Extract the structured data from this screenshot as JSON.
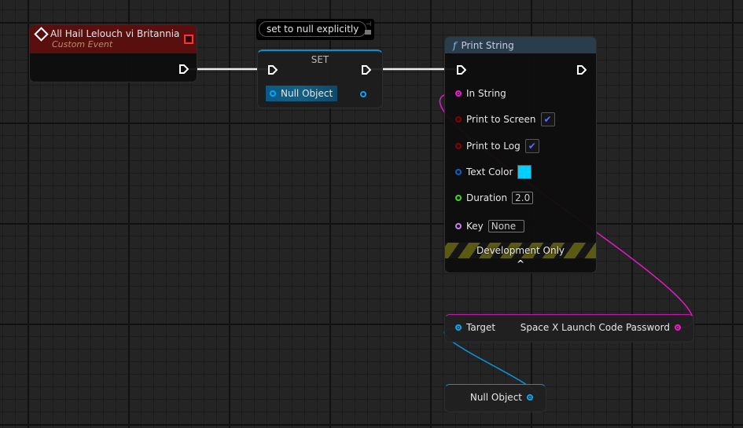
{
  "event_node": {
    "title": "All Hail Lelouch vi Britannia",
    "subtitle": "Custom Event",
    "header_color": "#5a0f0f"
  },
  "comment": {
    "text": "set to null explicitly"
  },
  "set_node": {
    "title": "SET",
    "pin_label": "Null Object"
  },
  "print_node": {
    "title": "Print String",
    "icon": "function-icon",
    "pins": {
      "in_string": "In String",
      "print_to_screen": "Print to Screen",
      "print_to_log": "Print to Log",
      "text_color": "Text Color",
      "duration": "Duration",
      "key": "Key"
    },
    "values": {
      "print_to_screen": true,
      "print_to_log": true,
      "text_color": "#00d0ff",
      "duration": "2.0",
      "key": "None"
    },
    "footer": "Development Only"
  },
  "getter_node": {
    "target_label": "Target",
    "output_label": "Space X Launch Code Password"
  },
  "null_node": {
    "label": "Null Object"
  },
  "colors": {
    "string_pin": "#f019d0",
    "object_pin": "#0aa6f0",
    "bool_pin": "#8c0000",
    "float_pin": "#3bdb17",
    "name_pin": "#c880ef"
  }
}
